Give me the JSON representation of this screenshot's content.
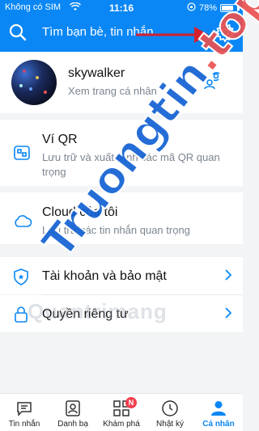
{
  "status_bar": {
    "carrier": "Không có SIM",
    "time": "11:16",
    "battery": "78%",
    "battery_level": 0.78
  },
  "header": {
    "search_placeholder": "Tìm bạn bè, tin nhắn"
  },
  "profile": {
    "name": "skywalker",
    "subtitle": "Xem trang cá nhân"
  },
  "menu": {
    "qr": {
      "title": "Ví QR",
      "desc": "Lưu trữ và xuất trình các mã QR quan trọng"
    },
    "cloud": {
      "title": "Cloud của tôi",
      "desc": "Lưu trữ các tin nhắn quan trọng"
    },
    "security": {
      "title": "Tài khoản và bảo mật"
    },
    "privacy": {
      "title": "Quyền riêng tư"
    }
  },
  "tabs": [
    {
      "label": "Tin nhắn",
      "icon": "chat-icon"
    },
    {
      "label": "Danh bạ",
      "icon": "contacts-icon"
    },
    {
      "label": "Khám phá",
      "icon": "grid-icon",
      "badge": "N"
    },
    {
      "label": "Nhật ký",
      "icon": "clock-icon"
    },
    {
      "label": "Cá nhân",
      "icon": "person-icon",
      "active": true
    }
  ],
  "watermark": {
    "text": "Quantrimang",
    "brand_a": "Truongtin",
    "brand_b": ".top"
  },
  "colors": {
    "primary": "#0a87f5",
    "badge": "#f2404f",
    "annotation_arrow": "#d6202e"
  }
}
